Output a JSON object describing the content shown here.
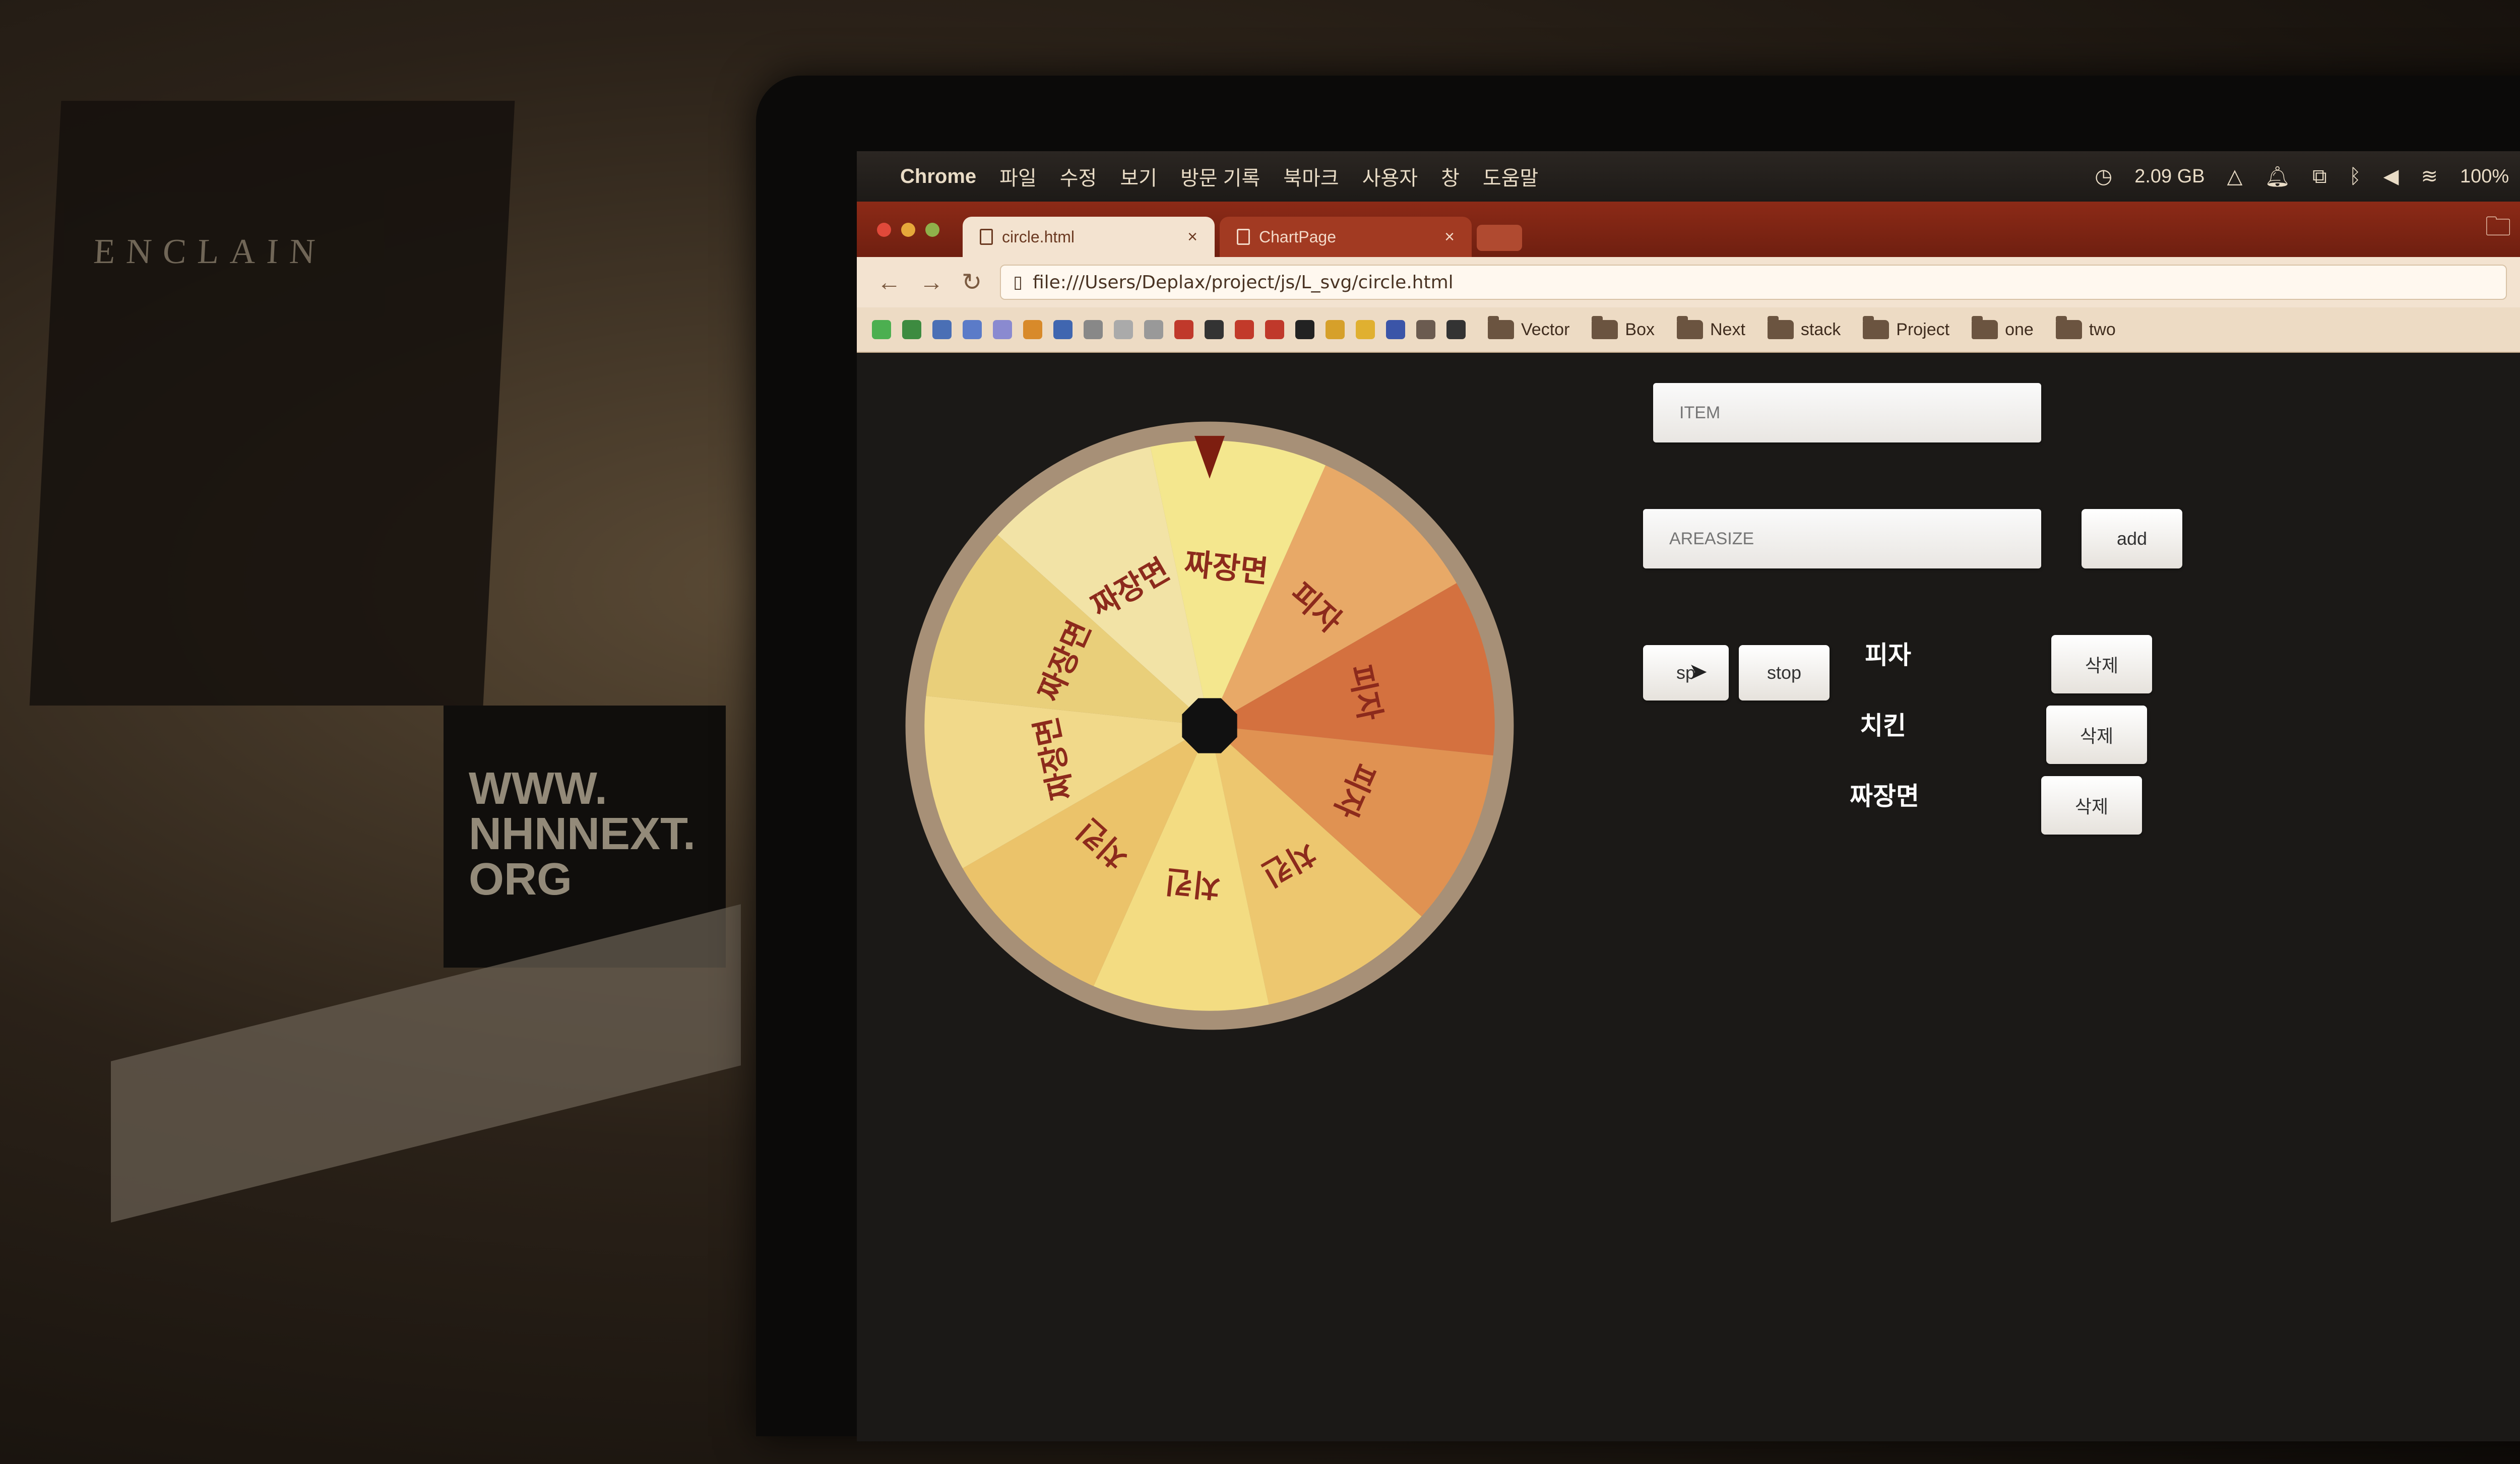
{
  "menubar": {
    "app_name": "Chrome",
    "menus": [
      "파일",
      "수정",
      "보기",
      "방문 기록",
      "북마크",
      "사용자",
      "창",
      "도움말"
    ],
    "memory": "2.09 GB",
    "battery": "100%"
  },
  "tabs": [
    {
      "title": "circle.html",
      "close": "×",
      "active": true
    },
    {
      "title": "ChartPage",
      "close": "×",
      "active": false
    }
  ],
  "address": {
    "url": "file:///Users/Deplax/project/js/L_svg/circle.html"
  },
  "bookmarks": [
    "Vector",
    "Box",
    "Next",
    "stack",
    "Project",
    "one",
    "two"
  ],
  "form": {
    "item_placeholder": "ITEM",
    "areasize_placeholder": "AREASIZE",
    "add_label": "add",
    "spin_label": "sp",
    "stop_label": "stop"
  },
  "items": [
    {
      "name": "피자",
      "delete_label": "삭제"
    },
    {
      "name": "치킨",
      "delete_label": "삭제"
    },
    {
      "name": "짜장면",
      "delete_label": "삭제"
    }
  ],
  "wheel": {
    "segments": [
      {
        "label": "짜장면",
        "color": "#f2e3a6"
      },
      {
        "label": "짜장면",
        "color": "#f4e78e"
      },
      {
        "label": "피자",
        "color": "#e8a967"
      },
      {
        "label": "피자",
        "color": "#d4713f"
      },
      {
        "label": "피자",
        "color": "#e09252"
      },
      {
        "label": "치킨",
        "color": "#edc76f"
      },
      {
        "label": "치킨",
        "color": "#f3dc82"
      },
      {
        "label": "치킨",
        "color": "#ebc36a"
      },
      {
        "label": "짜장면",
        "color": "#f1d98a"
      },
      {
        "label": "짜장면",
        "color": "#e9cf7a"
      }
    ],
    "pointer_color": "#7d1e10",
    "rim_color": "#a79077",
    "label_color": "#8c2a1c"
  },
  "desk": {
    "book_text": "ENCLAIN",
    "box_text": "WWW. NHNNEXT. ORG"
  }
}
